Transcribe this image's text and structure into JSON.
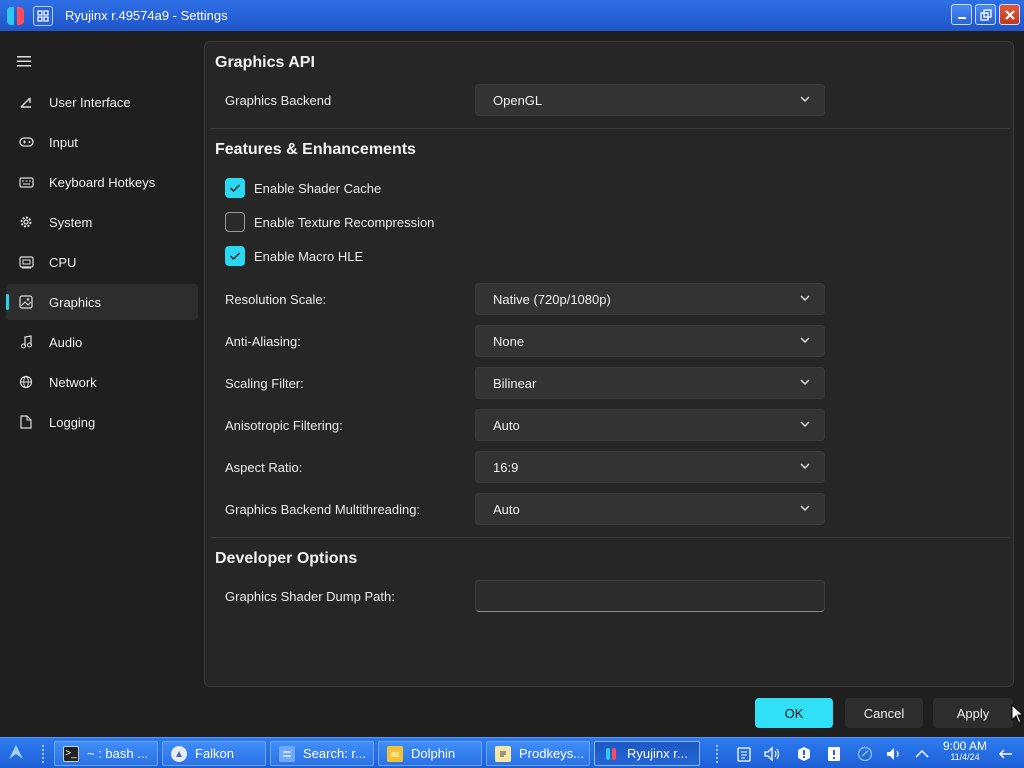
{
  "window": {
    "title": "Ryujinx r.49574a9 - Settings",
    "controls": [
      "minimize-icon",
      "maximize-icon",
      "close-icon"
    ]
  },
  "sidebar": {
    "items": [
      {
        "label": "User Interface",
        "icon": "ui-icon"
      },
      {
        "label": "Input",
        "icon": "gamepad-icon"
      },
      {
        "label": "Keyboard Hotkeys",
        "icon": "keyboard-icon"
      },
      {
        "label": "System",
        "icon": "gear-icon"
      },
      {
        "label": "CPU",
        "icon": "cpu-icon"
      },
      {
        "label": "Graphics",
        "icon": "image-icon",
        "active": true
      },
      {
        "label": "Audio",
        "icon": "music-icon"
      },
      {
        "label": "Network",
        "icon": "globe-icon"
      },
      {
        "label": "Logging",
        "icon": "document-icon"
      }
    ]
  },
  "graphics_api": {
    "title": "Graphics API",
    "backend_label": "Graphics Backend",
    "backend_value": "OpenGL"
  },
  "features": {
    "title": "Features & Enhancements",
    "checkboxes": [
      {
        "label": "Enable Shader Cache",
        "checked": true
      },
      {
        "label": "Enable Texture Recompression",
        "checked": false
      },
      {
        "label": "Enable Macro HLE",
        "checked": true
      }
    ],
    "settings": [
      {
        "label": "Resolution Scale:",
        "value": "Native (720p/1080p)"
      },
      {
        "label": "Anti-Aliasing:",
        "value": "None"
      },
      {
        "label": "Scaling Filter:",
        "value": "Bilinear"
      },
      {
        "label": "Anisotropic Filtering:",
        "value": "Auto"
      },
      {
        "label": "Aspect Ratio:",
        "value": "16:9"
      },
      {
        "label": "Graphics Backend Multithreading:",
        "value": "Auto"
      }
    ]
  },
  "developer": {
    "title": "Developer Options",
    "dump_path_label": "Graphics Shader Dump Path:",
    "dump_path_value": ""
  },
  "buttons": {
    "ok": "OK",
    "cancel": "Cancel",
    "apply": "Apply"
  },
  "taskbar": {
    "items": [
      {
        "label": "~ : bash ...",
        "icon": "terminal-icon"
      },
      {
        "label": "Falkon",
        "icon": "falkon-icon"
      },
      {
        "label": "Search: r...",
        "icon": "search-icon"
      },
      {
        "label": "Dolphin",
        "icon": "folder-icon"
      },
      {
        "label": "Prodkeys...",
        "icon": "notes-icon"
      },
      {
        "label": "Ryujinx r...",
        "icon": "ryujinx-icon",
        "active": true
      }
    ],
    "clock_time": "9:00 AM",
    "clock_date": "11/4/24"
  },
  "colors": {
    "accent": "#2bd8f3",
    "titlebar": "#2f6fe6",
    "background": "#1f1f1f",
    "panel": "#262626"
  }
}
